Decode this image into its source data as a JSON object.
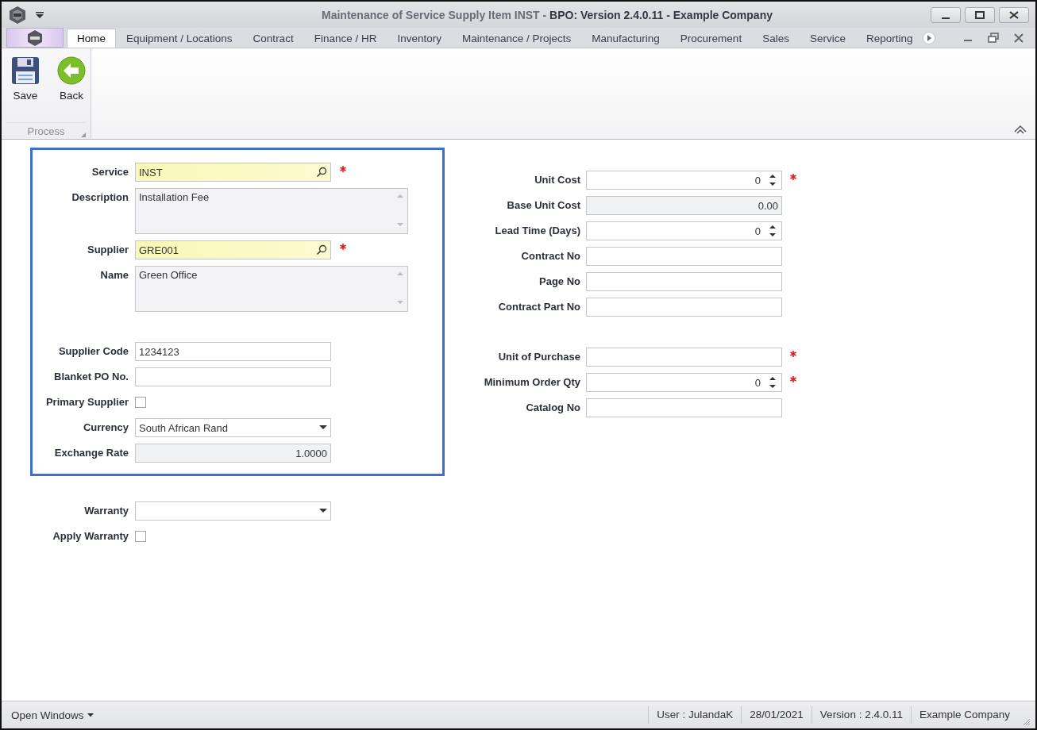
{
  "window": {
    "title": "Maintenance of Service Supply Item INST - **BPO: Version 2.4.0.11 - Example Company**"
  },
  "tabs": [
    {
      "label": "Home",
      "selected": true
    },
    {
      "label": "Equipment / Locations",
      "selected": false
    },
    {
      "label": "Contract",
      "selected": false
    },
    {
      "label": "Finance / HR",
      "selected": false
    },
    {
      "label": "Inventory",
      "selected": false
    },
    {
      "label": "Maintenance / Projects",
      "selected": false
    },
    {
      "label": "Manufacturing",
      "selected": false
    },
    {
      "label": "Procurement",
      "selected": false
    },
    {
      "label": "Sales",
      "selected": false
    },
    {
      "label": "Service",
      "selected": false
    },
    {
      "label": "Reporting",
      "selected": false
    }
  ],
  "ribbon": {
    "buttons": [
      {
        "kind": "save",
        "label": "Save"
      },
      {
        "kind": "back",
        "label": "Back"
      }
    ],
    "group_label": "Process"
  },
  "form": {
    "highlighted_groups": [
      {
        "fields": [
          {
            "kind": "lookup",
            "label": "Service",
            "value": "INST",
            "required": true
          },
          {
            "kind": "memo",
            "label": "Description",
            "value": "Installation Fee",
            "required": false
          },
          {
            "kind": "lookup",
            "label": "Supplier",
            "value": "GRE001",
            "required": true
          },
          {
            "kind": "memo",
            "label": "Name",
            "value": "Green Office",
            "required": false
          }
        ]
      },
      {
        "fields": [
          {
            "kind": "text",
            "label": "Supplier Code",
            "value": "1234123",
            "required": false
          },
          {
            "kind": "text",
            "label": "Blanket PO No.",
            "required": false
          },
          {
            "kind": "check",
            "label": "Primary Supplier",
            "checked": false,
            "required": false
          },
          {
            "kind": "combo",
            "label": "Currency",
            "value": "South African Rand",
            "required": false
          },
          {
            "kind": "number",
            "label": "Exchange Rate",
            "value": "1.0000",
            "readonly": true,
            "required": false
          }
        ]
      }
    ],
    "left_fields": [
      {
        "kind": "combo",
        "label": "Warranty",
        "required": false
      },
      {
        "kind": "check",
        "label": "Apply Warranty",
        "checked": false,
        "required": false
      }
    ],
    "right_groups": [
      {
        "fields": [
          {
            "kind": "spin",
            "label": "Unit Cost",
            "value": "0",
            "required": true
          },
          {
            "kind": "number",
            "label": "Base Unit Cost",
            "value": "0.00",
            "readonly": true,
            "required": false
          },
          {
            "kind": "spin",
            "label": "Lead Time (Days)",
            "value": "0",
            "required": false
          },
          {
            "kind": "text",
            "label": "Contract No",
            "required": false
          },
          {
            "kind": "text",
            "label": "Page No",
            "required": false
          },
          {
            "kind": "text",
            "label": "Contract Part No",
            "required": false
          }
        ]
      },
      {
        "fields": [
          {
            "kind": "text",
            "label": "Unit of Purchase",
            "required": true
          },
          {
            "kind": "spin",
            "label": "Minimum Order Qty",
            "value": "0",
            "required": true
          },
          {
            "kind": "text",
            "label": "Catalog No",
            "required": false
          }
        ]
      }
    ]
  },
  "status_bar": {
    "open_windows": "Open Windows",
    "items": [
      "User : JulandaK",
      "28/01/2021",
      "Version : 2.4.0.11",
      "Example Company"
    ]
  }
}
